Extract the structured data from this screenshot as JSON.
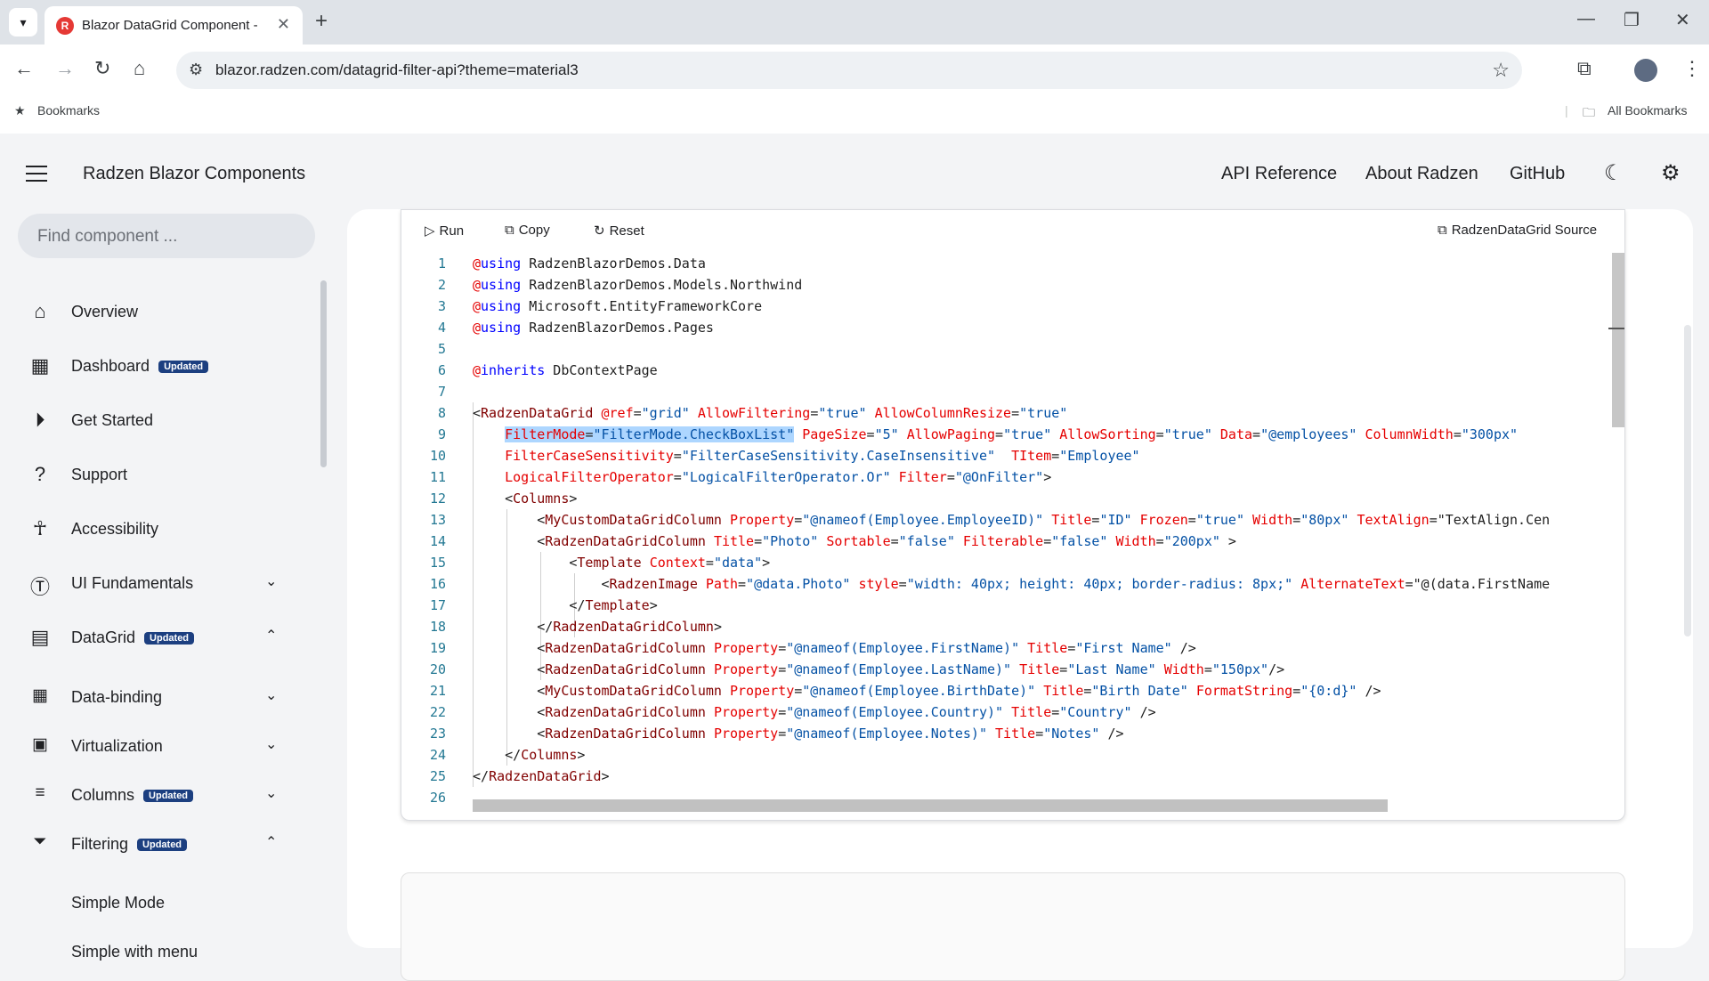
{
  "browser": {
    "tab_title": "Blazor DataGrid Component - R",
    "tab_favicon_letter": "R",
    "url": "blazor.radzen.com/datagrid-filter-api?theme=material3",
    "bookmarks_label": "Bookmarks",
    "all_bookmarks_label": "All Bookmarks"
  },
  "header": {
    "brand": "Radzen Blazor Components",
    "links": [
      "API Reference",
      "About Radzen",
      "GitHub"
    ]
  },
  "sidebar": {
    "search_placeholder": "Find component ...",
    "badge_label": "Updated",
    "items": [
      {
        "label": "Overview",
        "icon": "home-icon"
      },
      {
        "label": "Dashboard",
        "icon": "dashboard-icon",
        "badge": true
      },
      {
        "label": "Get Started",
        "icon": "play-circle-icon"
      },
      {
        "label": "Support",
        "icon": "help-icon"
      },
      {
        "label": "Accessibility",
        "icon": "accessibility-icon"
      },
      {
        "label": "UI Fundamentals",
        "icon": "text-settings-icon",
        "chevron": "down"
      },
      {
        "label": "DataGrid",
        "icon": "table-icon",
        "badge": true,
        "chevron": "up"
      },
      {
        "label": "Data-binding",
        "icon": "grid-icon",
        "chevron": "down"
      },
      {
        "label": "Virtualization",
        "icon": "virtualization-icon",
        "chevron": "down"
      },
      {
        "label": "Columns",
        "icon": "columns-icon",
        "badge": true,
        "chevron": "down"
      },
      {
        "label": "Filtering",
        "icon": "filter-icon",
        "badge": true,
        "chevron": "up"
      }
    ],
    "sub_items": [
      "Simple Mode",
      "Simple with menu"
    ]
  },
  "toolbar": {
    "run_label": "Run",
    "copy_label": "Copy",
    "reset_label": "Reset",
    "source_label": "RadzenDataGrid Source"
  },
  "code_lines": [
    "@using RadzenBlazorDemos.Data",
    "@using RadzenBlazorDemos.Models.Northwind",
    "@using Microsoft.EntityFrameworkCore",
    "@using RadzenBlazorDemos.Pages",
    "",
    "@inherits DbContextPage",
    "",
    "<RadzenDataGrid @ref=\"grid\" AllowFiltering=\"true\" AllowColumnResize=\"true\"",
    "    FilterMode=\"FilterMode.CheckBoxList\" PageSize=\"5\" AllowPaging=\"true\" AllowSorting=\"true\" Data=\"@employees\" ColumnWidth=\"300px\"",
    "    FilterCaseSensitivity=\"FilterCaseSensitivity.CaseInsensitive\"  TItem=\"Employee\"",
    "    LogicalFilterOperator=\"LogicalFilterOperator.Or\" Filter=\"@OnFilter\">",
    "    <Columns>",
    "        <MyCustomDataGridColumn Property=\"@nameof(Employee.EmployeeID)\" Title=\"ID\" Frozen=\"true\" Width=\"80px\" TextAlign=\"TextAlign.Cen",
    "        <RadzenDataGridColumn Title=\"Photo\" Sortable=\"false\" Filterable=\"false\" Width=\"200px\" >",
    "            <Template Context=\"data\">",
    "                <RadzenImage Path=\"@data.Photo\" style=\"width: 40px; height: 40px; border-radius: 8px;\" AlternateText=\"@(data.FirstName",
    "            </Template>",
    "        </RadzenDataGridColumn>",
    "        <RadzenDataGridColumn Property=\"@nameof(Employee.FirstName)\" Title=\"First Name\" />",
    "        <RadzenDataGridColumn Property=\"@nameof(Employee.LastName)\" Title=\"Last Name\" Width=\"150px\"/>",
    "        <MyCustomDataGridColumn Property=\"@nameof(Employee.BirthDate)\" Title=\"Birth Date\" FormatString=\"{0:d}\" />",
    "        <RadzenDataGridColumn Property=\"@nameof(Employee.Country)\" Title=\"Country\" />",
    "        <RadzenDataGridColumn Property=\"@nameof(Employee.Notes)\" Title=\"Notes\" />",
    "    </Columns>",
    "</RadzenDataGrid>",
    ""
  ],
  "highlighted_text": "FilterMode=\"FilterMode.CheckBoxList\"",
  "highlighted_line": 9,
  "colors": {
    "accent_badge": "#1c3f80",
    "keyword": "#0000ff",
    "attribute": "#e50000",
    "string": "#0451a5",
    "tag": "#800000",
    "line_number": "#237893",
    "selection": "#add6ff"
  }
}
